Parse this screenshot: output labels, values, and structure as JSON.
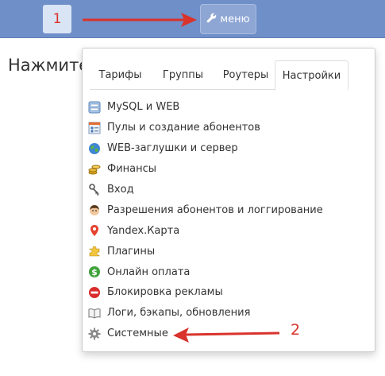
{
  "topbar": {
    "badge_number": "1",
    "menu_label": "меню"
  },
  "page": {
    "heading": "Нажмите"
  },
  "annotation": {
    "second_number": "2",
    "arrow_color": "#d9332c"
  },
  "tabs": [
    {
      "label": "Тарифы",
      "active": false
    },
    {
      "label": "Группы",
      "active": false
    },
    {
      "label": "Роутеры",
      "active": false
    },
    {
      "label": "Настройки",
      "active": true
    }
  ],
  "menu_items": [
    {
      "label": "MySQL и WEB",
      "icon": "database-icon"
    },
    {
      "label": "Пулы и создание абонентов",
      "icon": "user-list-icon"
    },
    {
      "label": "WEB-заглушки и сервер",
      "icon": "globe-icon"
    },
    {
      "label": "Финансы",
      "icon": "coins-icon"
    },
    {
      "label": "Вход",
      "icon": "keys-icon"
    },
    {
      "label": "Разрешения абонентов и логгирование",
      "icon": "user-face-icon"
    },
    {
      "label": "Yandex.Карта",
      "icon": "map-pin-icon"
    },
    {
      "label": "Плагины",
      "icon": "puzzle-icon"
    },
    {
      "label": "Онлайн оплата",
      "icon": "dollar-icon"
    },
    {
      "label": "Блокировка рекламы",
      "icon": "no-entry-icon"
    },
    {
      "label": "Логи, бэкапы, обновления",
      "icon": "book-icon"
    },
    {
      "label": "Системные",
      "icon": "gear-icon"
    }
  ]
}
